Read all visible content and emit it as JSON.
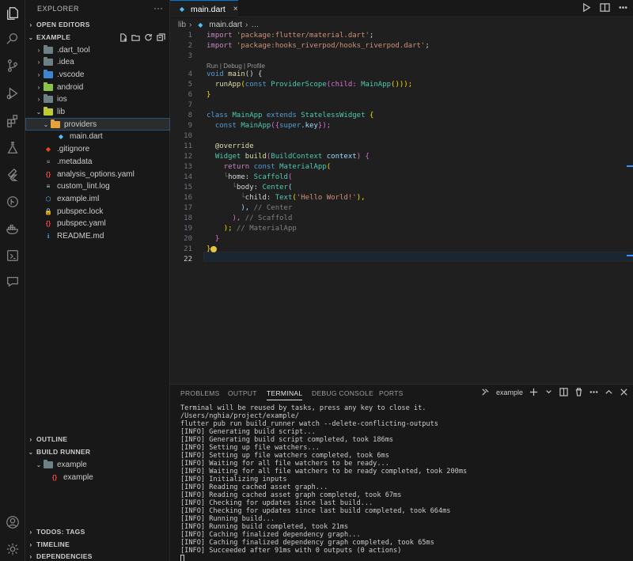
{
  "sidebar": {
    "title": "EXPLORER",
    "more": "···",
    "open_editors": "OPEN EDITORS",
    "root": "EXAMPLE",
    "tree": [
      {
        "label": ".dart_tool",
        "kind": "folder",
        "depth": 1,
        "color": "#6d8086",
        "expanded": false
      },
      {
        "label": ".idea",
        "kind": "folder",
        "depth": 1,
        "color": "#6d8086",
        "expanded": false
      },
      {
        "label": ".vscode",
        "kind": "folder",
        "depth": 1,
        "color": "#3e86d1",
        "expanded": false
      },
      {
        "label": "android",
        "kind": "folder",
        "depth": 1,
        "color": "#8bc34a",
        "expanded": false
      },
      {
        "label": "ios",
        "kind": "folder",
        "depth": 1,
        "color": "#6d8086",
        "expanded": false
      },
      {
        "label": "lib",
        "kind": "folder",
        "depth": 1,
        "color": "#c0ca33",
        "expanded": true
      },
      {
        "label": "providers",
        "kind": "folder",
        "depth": 2,
        "color": "#e6a23c",
        "expanded": true,
        "selected": true
      },
      {
        "label": "main.dart",
        "kind": "dart",
        "depth": 3,
        "color": "#4fc3f7"
      },
      {
        "label": ".gitignore",
        "kind": "git",
        "depth": 1,
        "color": "#e64a19"
      },
      {
        "label": ".metadata",
        "kind": "file",
        "depth": 1,
        "color": "#9e9e9e"
      },
      {
        "label": "analysis_options.yaml",
        "kind": "yaml",
        "depth": 1,
        "color": "#f44747"
      },
      {
        "label": "custom_lint.log",
        "kind": "log",
        "depth": 1,
        "color": "#cccccc"
      },
      {
        "label": "example.iml",
        "kind": "iml",
        "depth": 1,
        "color": "#4fc3f7"
      },
      {
        "label": "pubspec.lock",
        "kind": "lock",
        "depth": 1,
        "color": "#e2c541"
      },
      {
        "label": "pubspec.yaml",
        "kind": "yaml",
        "depth": 1,
        "color": "#f44747"
      },
      {
        "label": "README.md",
        "kind": "info",
        "depth": 1,
        "color": "#3794ff"
      }
    ],
    "outline": "OUTLINE",
    "build_runner": "BUILD RUNNER",
    "build_items": [
      "example",
      "example"
    ],
    "todos": "TODOS: TAGS",
    "timeline": "TIMELINE",
    "dependencies": "DEPENDENCIES"
  },
  "tab": {
    "label": "main.dart",
    "close": "×"
  },
  "breadcrumb": {
    "folder": "lib",
    "sep": "›",
    "file": "main.dart",
    "more": "…"
  },
  "codelens": "Run | Debug | Profile",
  "editor_lines": [
    {
      "n": "1"
    },
    {
      "n": "2"
    },
    {
      "n": "3"
    },
    {
      "n": "4"
    },
    {
      "n": "5"
    },
    {
      "n": "6"
    },
    {
      "n": "7"
    },
    {
      "n": "8"
    },
    {
      "n": "9"
    },
    {
      "n": "10"
    },
    {
      "n": "11"
    },
    {
      "n": "12"
    },
    {
      "n": "13"
    },
    {
      "n": "14"
    },
    {
      "n": "15"
    },
    {
      "n": "16"
    },
    {
      "n": "17"
    },
    {
      "n": "18"
    },
    {
      "n": "19"
    },
    {
      "n": "20"
    },
    {
      "n": "21"
    },
    {
      "n": "22"
    }
  ],
  "code": {
    "l1_kw": "import",
    "l1_str": "'package:flutter/material.dart'",
    "l1_end": ";",
    "l2_kw": "import",
    "l2_str": "'package:hooks_riverpod/hooks_riverpod.dart'",
    "l2_end": ";",
    "l4_kw": "void",
    "l4_fn": "main",
    "l4_rest": "() {",
    "l5_fn": "runApp",
    "l5_a": "(",
    "l5_kw": "const",
    "l5_cls": "ProviderScope",
    "l5_b": "(child: ",
    "l5_cls2": "MainApp",
    "l5_c": "()));",
    "l6": "}",
    "l8_kw": "class",
    "l8_cls": "MainApp",
    "l8_kw2": "extends",
    "l8_cls2": "StatelessWidget",
    "l8_end": "{",
    "l9_kw": "const",
    "l9_cls": "MainApp",
    "l9_a": "({",
    "l9_kw2": "super",
    "l9_p": ".key",
    "l9_b": "});",
    "l11": "@override",
    "l12_cls": "Widget",
    "l12_fn": "build",
    "l12_a": "(",
    "l12_cls2": "BuildContext",
    "l12_p": "context",
    "l12_b": ") {",
    "l13_kw": "return",
    "l13_kw2": "const",
    "l13_cls": "MaterialApp",
    "l13_a": "(",
    "l14_guide": "└",
    "l14_a": "home: ",
    "l14_cls": "Scaffold",
    "l14_b": "(",
    "l15_guide": "└",
    "l15_a": "body: ",
    "l15_cls": "Center",
    "l15_b": "(",
    "l16_guide": "└",
    "l16_a": "child: ",
    "l16_cls": "Text",
    "l16_b": "(",
    "l16_str": "'Hello World!'",
    "l16_c": "),",
    "l17_a": "), ",
    "l17_cm": "// Center",
    "l18_a": "), ",
    "l18_cm": "// Scaffold",
    "l19_a": "); ",
    "l19_cm": "// MaterialApp",
    "l20": "}",
    "l21": "}"
  },
  "panel": {
    "tabs": [
      "PROBLEMS",
      "OUTPUT",
      "TERMINAL",
      "DEBUG CONSOLE",
      "PORTS"
    ],
    "active_tab": "TERMINAL",
    "terminal_name": "example",
    "terminal_lines": [
      "Terminal will be reused by tasks, press any key to close it.",
      "/Users/nghia/project/example/",
      "flutter pub run build_runner watch --delete-conflicting-outputs",
      "[INFO] Generating build script...",
      "[INFO] Generating build script completed, took 186ms",
      "[INFO] Setting up file watchers...",
      "[INFO] Setting up file watchers completed, took 6ms",
      "[INFO] Waiting for all file watchers to be ready...",
      "[INFO] Waiting for all file watchers to be ready completed, took 200ms",
      "[INFO] Initializing inputs",
      "[INFO] Reading cached asset graph...",
      "[INFO] Reading cached asset graph completed, took 67ms",
      "[INFO] Checking for updates since last build...",
      "[INFO] Checking for updates since last build completed, took 664ms",
      "[INFO] Running build...",
      "[INFO] Running build completed, took 21ms",
      "[INFO] Caching finalized dependency graph...",
      "[INFO] Caching finalized dependency graph completed, took 65ms",
      "[INFO] Succeeded after 91ms with 0 outputs (0 actions)"
    ]
  }
}
